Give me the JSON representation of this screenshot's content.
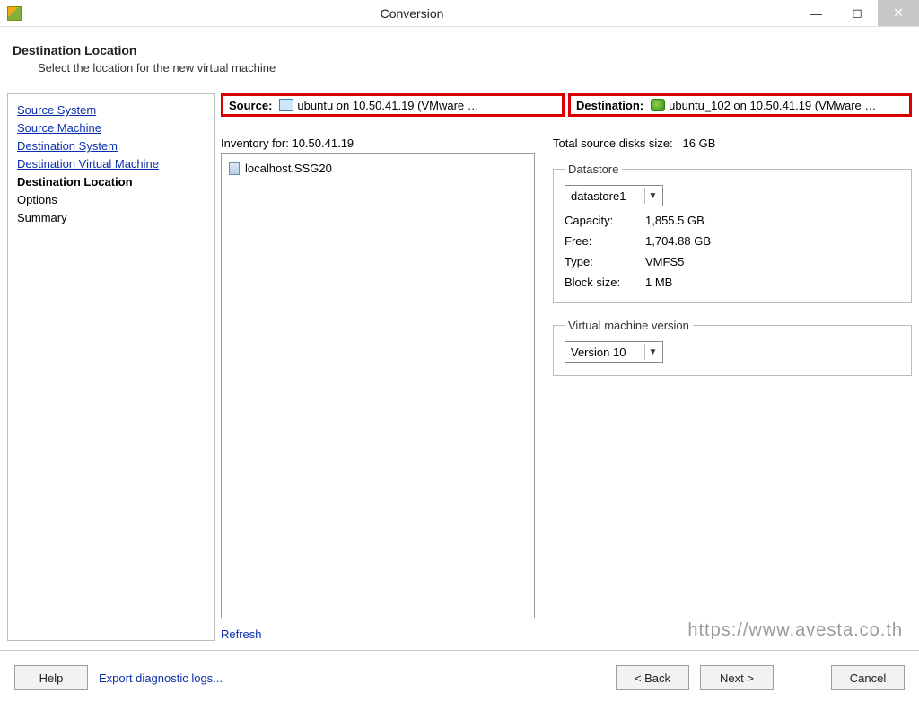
{
  "window": {
    "title": "Conversion"
  },
  "header": {
    "title": "Destination Location",
    "subtitle": "Select the location for the new virtual machine"
  },
  "sidebar": {
    "items": [
      {
        "label": "Source System",
        "link": true
      },
      {
        "label": "Source Machine",
        "link": true
      },
      {
        "label": "Destination System",
        "link": true
      },
      {
        "label": "Destination Virtual Machine",
        "link": true
      },
      {
        "label": "Destination Location",
        "current": true
      },
      {
        "label": "Options",
        "plain": true
      },
      {
        "label": "Summary",
        "plain": true
      }
    ]
  },
  "srcdest": {
    "source_label": "Source:",
    "source_text": "ubuntu on 10.50.41.19 (VMware …",
    "dest_label": "Destination:",
    "dest_text": "ubuntu_102 on 10.50.41.19 (VMware …"
  },
  "inventory": {
    "label": "Inventory for: 10.50.41.19",
    "items": [
      "localhost.SSG20"
    ],
    "refresh": "Refresh"
  },
  "right": {
    "total_label": "Total source disks size:",
    "total_value": "16 GB",
    "datastore": {
      "legend": "Datastore",
      "selected": "datastore1",
      "rows": {
        "capacity_k": "Capacity:",
        "capacity_v": "1,855.5 GB",
        "free_k": "Free:",
        "free_v": "1,704.88 GB",
        "type_k": "Type:",
        "type_v": "VMFS5",
        "bs_k": "Block size:",
        "bs_v": "1 MB"
      }
    },
    "vmver": {
      "legend": "Virtual machine version",
      "selected": "Version 10"
    }
  },
  "footer": {
    "help": "Help",
    "diag": "Export diagnostic logs...",
    "back": "< Back",
    "next": "Next >",
    "cancel": "Cancel"
  },
  "watermark": "https://www.avesta.co.th"
}
